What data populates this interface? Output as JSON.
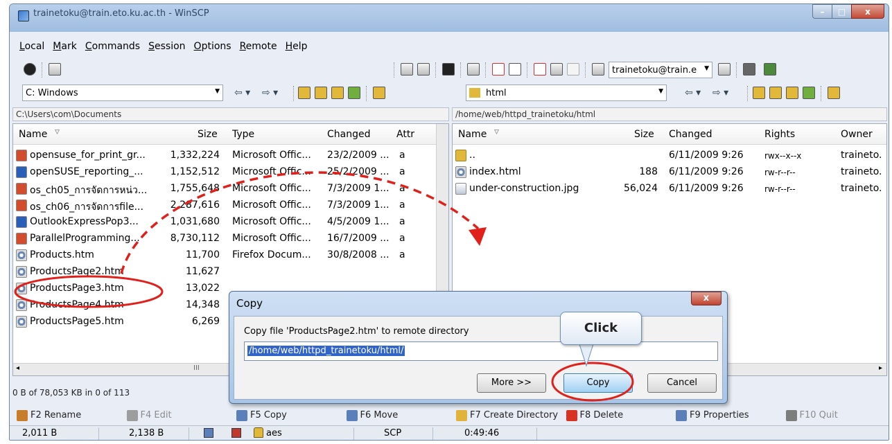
{
  "window": {
    "title": "trainetoku@train.eto.ku.ac.th - WinSCP"
  },
  "menu": [
    "Local",
    "Mark",
    "Commands",
    "Session",
    "Options",
    "Remote",
    "Help"
  ],
  "toolbar": {
    "session_combo": "trainetoku@train.e"
  },
  "local": {
    "drive": "C: Windows",
    "path": "C:\\Users\\com\\Documents",
    "columns": [
      "Name",
      "Size",
      "Type",
      "Changed",
      "Attr"
    ],
    "files": [
      {
        "icon": "ppt",
        "name": "opensuse_for_print_gr...",
        "size": "1,332,224",
        "type": "Microsoft Offic...",
        "changed": "23/2/2009 ...",
        "attr": "a"
      },
      {
        "icon": "doc",
        "name": "openSUSE_reporting_...",
        "size": "1,152,512",
        "type": "Microsoft Offic...",
        "changed": "25/2/2009 ...",
        "attr": "a"
      },
      {
        "icon": "ppt",
        "name": "os_ch05_การจัดการหน่ว...",
        "size": "1,755,648",
        "type": "Microsoft Offic...",
        "changed": "7/3/2009 1...",
        "attr": "a"
      },
      {
        "icon": "ppt",
        "name": "os_ch06_การจัดการfile...",
        "size": "2,287,616",
        "type": "Microsoft Offic...",
        "changed": "7/3/2009 1...",
        "attr": "a"
      },
      {
        "icon": "doc",
        "name": "OutlookExpressPop3...",
        "size": "1,031,680",
        "type": "Microsoft Offic...",
        "changed": "4/5/2009 1...",
        "attr": "a"
      },
      {
        "icon": "ppt",
        "name": "ParallelProgramming...",
        "size": "8,730,112",
        "type": "Microsoft Offic...",
        "changed": "16/7/2009 ...",
        "attr": "a"
      },
      {
        "icon": "htm",
        "name": "Products.htm",
        "size": "11,700",
        "type": "Firefox Docum...",
        "changed": "30/8/2008 ...",
        "attr": "a"
      },
      {
        "icon": "htm",
        "name": "ProductsPage2.htm",
        "size": "11,627",
        "type": "",
        "changed": "",
        "attr": ""
      },
      {
        "icon": "htm",
        "name": "ProductsPage3.htm",
        "size": "13,022",
        "type": "",
        "changed": "",
        "attr": ""
      },
      {
        "icon": "htm",
        "name": "ProductsPage4.htm",
        "size": "14,348",
        "type": "",
        "changed": "",
        "attr": ""
      },
      {
        "icon": "htm",
        "name": "ProductsPage5.htm",
        "size": "6,269",
        "type": "",
        "changed": "",
        "attr": ""
      }
    ],
    "status": "0 B of 78,053 KB in 0 of 113"
  },
  "remote": {
    "dir": "html",
    "path": "/home/web/httpd_trainetoku/html",
    "columns": [
      "Name",
      "Size",
      "Changed",
      "Rights",
      "Owner"
    ],
    "files": [
      {
        "icon": "up",
        "name": "..",
        "size": "",
        "changed": "6/11/2009 9:26",
        "rights": "rwx--x--x",
        "owner": "traineto."
      },
      {
        "icon": "htm",
        "name": "index.html",
        "size": "188",
        "changed": "6/11/2009 9:26",
        "rights": "rw-r--r--",
        "owner": "traineto."
      },
      {
        "icon": "jpg",
        "name": "under-construction.jpg",
        "size": "56,024",
        "changed": "6/11/2009 9:26",
        "rights": "rw-r--r--",
        "owner": "traineto."
      }
    ]
  },
  "fkeys": [
    {
      "label": "F2 Rename",
      "dim": false,
      "color": "#c77d2a"
    },
    {
      "label": "F4 Edit",
      "dim": true,
      "color": "#9d9d9d"
    },
    {
      "label": "F5 Copy",
      "dim": false,
      "color": "#5b7fb8"
    },
    {
      "label": "F6 Move",
      "dim": false,
      "color": "#5b7fb8"
    },
    {
      "label": "F7 Create Directory",
      "dim": false,
      "color": "#e0b33a"
    },
    {
      "label": "F8 Delete",
      "dim": false,
      "color": "#d83322"
    },
    {
      "label": "F9 Properties",
      "dim": false,
      "color": "#5b7fb8"
    },
    {
      "label": "F10 Quit",
      "dim": true,
      "color": "#7d7d7d"
    }
  ],
  "statusbar": {
    "uploaded": "2,011 B",
    "downloaded": "2,138 B",
    "cipher": "aes",
    "protocol": "SCP",
    "time": "0:49:46"
  },
  "dialog": {
    "title": "Copy",
    "close": "x",
    "prompt": "Copy file 'ProductsPage2.htm' to remote directory",
    "target": "/home/web/httpd_trainetoku/html/",
    "more_button": "More >>",
    "copy_button": "Copy",
    "cancel_button": "Cancel"
  },
  "annotation": {
    "callout": "Click",
    "accent_color": "#e0201b"
  }
}
